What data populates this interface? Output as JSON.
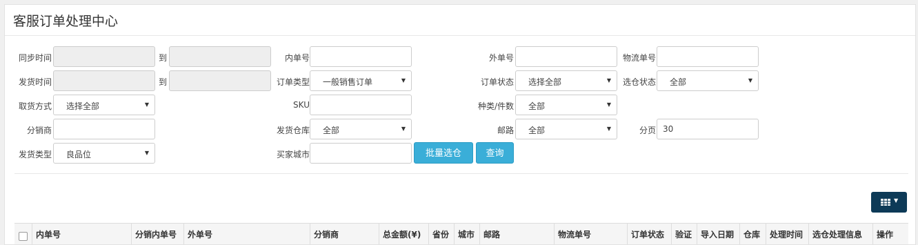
{
  "page": {
    "title": "客服订单处理中心"
  },
  "filters": {
    "sync_time": {
      "label": "同步时间",
      "to": "到"
    },
    "ship_time": {
      "label": "发货时间",
      "to": "到"
    },
    "inner_no": {
      "label": "内单号",
      "value": ""
    },
    "outer_no": {
      "label": "外单号",
      "value": ""
    },
    "logistics_no": {
      "label": "物流单号",
      "value": ""
    },
    "order_type": {
      "label": "订单类型",
      "value": "一般销售订单"
    },
    "order_status": {
      "label": "订单状态",
      "value": "选择全部"
    },
    "warehouse_select_status": {
      "label": "选仓状态",
      "value": "全部"
    },
    "pickup_method": {
      "label": "取货方式",
      "value": "选择全部"
    },
    "sku": {
      "label": "SKU",
      "value": ""
    },
    "kind_count": {
      "label": "种类/件数",
      "value": "全部"
    },
    "distributor": {
      "label": "分销商",
      "value": ""
    },
    "ship_warehouse": {
      "label": "发货仓库",
      "value": "全部"
    },
    "mail_route": {
      "label": "邮路",
      "value": "全部"
    },
    "page_size": {
      "label": "分页",
      "value": "30"
    },
    "ship_type": {
      "label": "发货类型",
      "value": "良品位"
    },
    "buyer_city": {
      "label": "买家城市",
      "value": ""
    }
  },
  "buttons": {
    "batch_select": "批量选仓",
    "query": "查询"
  },
  "table": {
    "columns": [
      "内单号",
      "分销内单号",
      "外单号",
      "分销商",
      "总金额(¥)",
      "省份",
      "城市",
      "邮路",
      "物流单号",
      "订单状态",
      "验证",
      "导入日期",
      "仓库",
      "处理时间",
      "选仓处理信息",
      "操作"
    ]
  }
}
